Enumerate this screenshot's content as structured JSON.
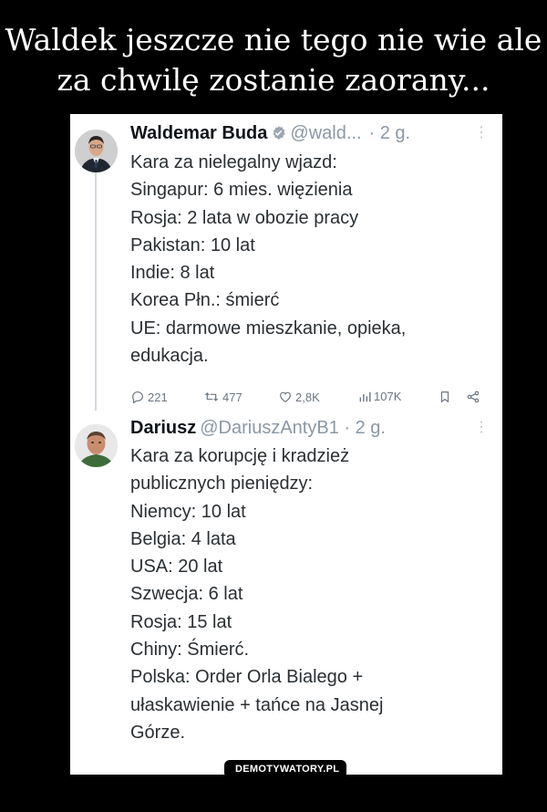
{
  "caption": {
    "line1": "Waldek jeszcze nie tego nie wie ale",
    "line2": "za chwilę zostanie zaorany..."
  },
  "tweets": [
    {
      "name": "Waldemar Buda",
      "handle": "@wald...",
      "time": "· 2 g.",
      "lines": [
        "Kara za nielegalny wjazd:",
        "Singapur: 6 mies. więzienia",
        "Rosja: 2 lata w obozie pracy",
        "Pakistan: 10 lat",
        "Indie: 8 lat",
        "Korea Płn.: śmierć",
        "UE: darmowe mieszkanie, opieka,",
        "edukacja."
      ],
      "stats": {
        "replies": "221",
        "retweets": "477",
        "likes": "2,8K",
        "views": "107K"
      }
    },
    {
      "name": "Dariusz",
      "handle": "@DariuszAntyB1 · 2 g.",
      "lines": [
        "Kara za korupcję i kradzież",
        "publicznych pieniędzy:",
        "Niemcy: 10 lat",
        "Belgia: 4 lata",
        "USA: 20 lat",
        "Szwecja: 6 lat",
        "Rosja: 15 lat",
        "Chiny: Śmierć.",
        "Polska: Order Orla Bialego +",
        "ułaskawienie + tańce na Jasnej",
        "Górze."
      ]
    }
  ],
  "watermark": "DEMOTYWATORY.PL",
  "colors": {
    "background": "#000000",
    "card": "#ffffff",
    "verified": "#1d9bf0",
    "muted": "#8b98a5"
  }
}
